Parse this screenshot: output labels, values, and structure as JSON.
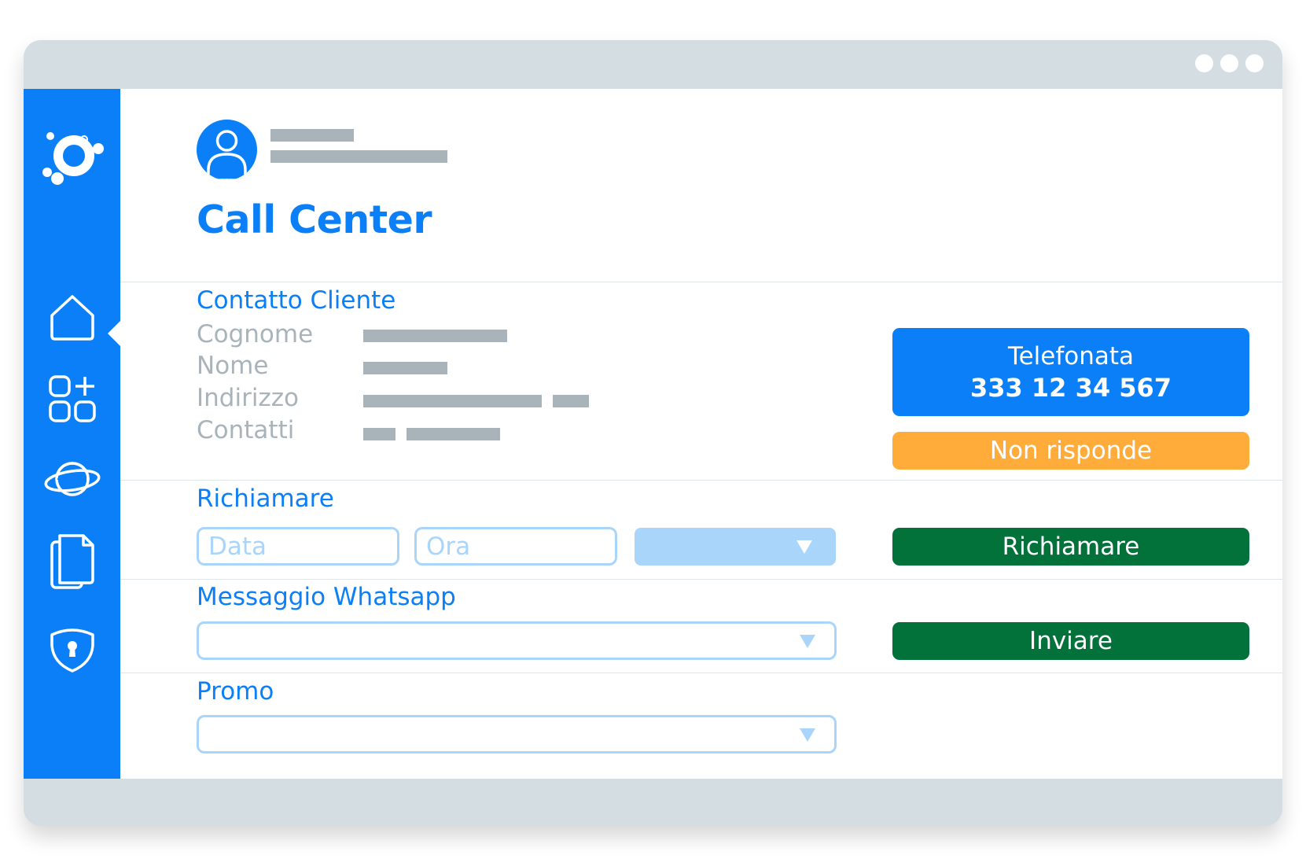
{
  "window": {
    "controls": [
      "window-dot",
      "window-dot",
      "window-dot"
    ]
  },
  "sidebar": {
    "logo_icon": "orbit-logo",
    "items": [
      {
        "icon": "home-icon",
        "active": true
      },
      {
        "icon": "apps-add-icon",
        "active": false
      },
      {
        "icon": "planet-icon",
        "active": false
      },
      {
        "icon": "documents-icon",
        "active": false
      },
      {
        "icon": "shield-lock-icon",
        "active": false
      }
    ]
  },
  "header": {
    "title": "Call Center",
    "avatar_icon": "user-icon"
  },
  "contact": {
    "section_title": "Contatto Cliente",
    "fields": [
      {
        "label": "Cognome"
      },
      {
        "label": "Nome"
      },
      {
        "label": "Indirizzo"
      },
      {
        "label": "Contatti"
      }
    ]
  },
  "actions": {
    "call_label": "Telefonata",
    "call_number": "333 12 34 567",
    "no_answer_label": "Non risponde"
  },
  "callback": {
    "section_title": "Richiamare",
    "date_placeholder": "Data",
    "time_placeholder": "Ora",
    "button_label": "Richiamare"
  },
  "whatsapp": {
    "section_title": "Messaggio Whatsapp",
    "button_label": "Inviare"
  },
  "promo": {
    "section_title": "Promo"
  },
  "colors": {
    "primary": "#0a7ff8",
    "orange": "#ffac3a",
    "green": "#02713a",
    "placeholder_gray": "#a8b4ba",
    "input_border": "#a9d5fb",
    "chrome": "#d4dde2"
  }
}
